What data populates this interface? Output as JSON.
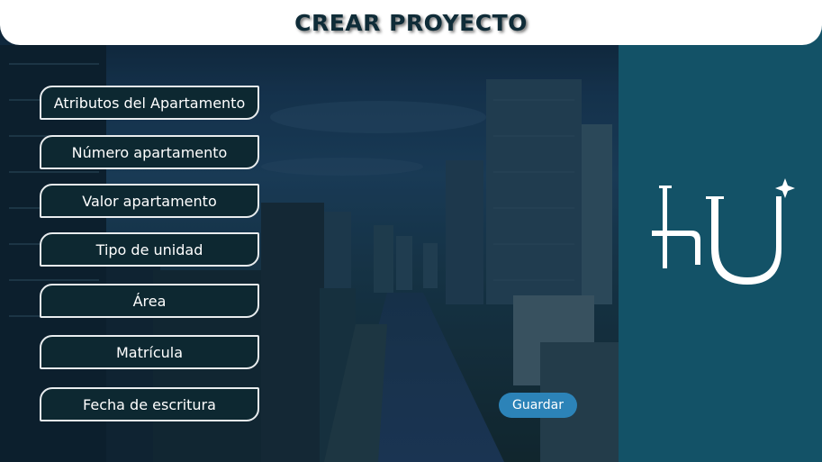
{
  "header": {
    "title": "CREAR PROYECTO"
  },
  "form": {
    "fields": [
      {
        "label": "Atributos del Apartamento"
      },
      {
        "label": "Número apartamento"
      },
      {
        "label": "Valor apartamento"
      },
      {
        "label": "Tipo de unidad"
      },
      {
        "label": "Área"
      },
      {
        "label": "Matrícula"
      },
      {
        "label": "Fecha de escritura"
      }
    ],
    "save_label": "Guardar"
  },
  "colors": {
    "header_bg": "#ffffff",
    "title_text": "#0f2c38",
    "panel_bg": "#135267",
    "field_bg": "#0d2831",
    "button_bg": "#2c83b8"
  },
  "logo": {
    "icon": "hu-logo-icon"
  }
}
